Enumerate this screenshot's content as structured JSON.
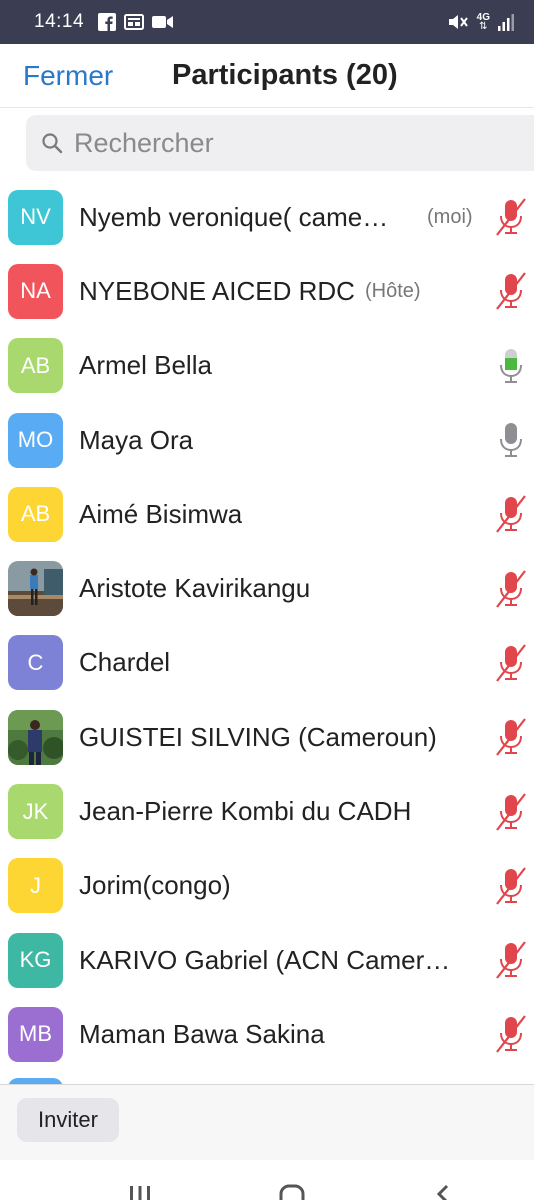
{
  "status_bar": {
    "time": "14:14",
    "left_icons": [
      "facebook-icon",
      "gallery-icon",
      "video-camera-icon"
    ],
    "right_icons": [
      "mute-vibrate-icon",
      "4g-data-icon",
      "signal-icon"
    ],
    "network_label": "4G"
  },
  "header": {
    "close_label": "Fermer",
    "title": "Participants (20)"
  },
  "search": {
    "placeholder": "Rechercher"
  },
  "colors": {
    "accent": "#2a78c9",
    "mic_muted": "#e0464b",
    "mic_active": "#4cb83f",
    "mic_idle": "#8e8e93"
  },
  "participants": [
    {
      "initials": "NV",
      "name": "Nyemb veronique( came…",
      "tag": "(moi)",
      "avatar_color": "#3ec6d6",
      "mic": "muted"
    },
    {
      "initials": "NA",
      "name": "NYEBONE AICED RDC",
      "tag": "(Hôte)",
      "avatar_color": "#f2545b",
      "mic": "muted"
    },
    {
      "initials": "AB",
      "name": "Armel Bella",
      "tag": "",
      "avatar_color": "#a8d86e",
      "mic": "active"
    },
    {
      "initials": "MO",
      "name": "Maya Ora",
      "tag": "",
      "avatar_color": "#59abf3",
      "mic": "idle"
    },
    {
      "initials": "AB",
      "name": "Aimé Bisimwa",
      "tag": "",
      "avatar_color": "#fdd633",
      "mic": "muted"
    },
    {
      "initials": "",
      "name": "Aristote Kavirikangu",
      "tag": "",
      "avatar_color": "#6b5a4a",
      "mic": "muted",
      "photo": true
    },
    {
      "initials": "C",
      "name": "Chardel",
      "tag": "",
      "avatar_color": "#7d82d6",
      "mic": "muted"
    },
    {
      "initials": "",
      "name": "GUISTEI SILVING (Cameroun)",
      "tag": "",
      "avatar_color": "#3b6b3a",
      "mic": "muted",
      "photo": true
    },
    {
      "initials": "JK",
      "name": "Jean-Pierre Kombi du CADH",
      "tag": "",
      "avatar_color": "#a8d86e",
      "mic": "muted"
    },
    {
      "initials": "J",
      "name": "Jorim(congo)",
      "tag": "",
      "avatar_color": "#fdd633",
      "mic": "muted"
    },
    {
      "initials": "KG",
      "name": "KARIVO Gabriel (ACN Camer…",
      "tag": "",
      "avatar_color": "#3eb8a3",
      "mic": "muted"
    },
    {
      "initials": "MB",
      "name": "Maman Bawa Sakina",
      "tag": "",
      "avatar_color": "#9a6fd1",
      "mic": "muted"
    }
  ],
  "bottom": {
    "invite_label": "Inviter"
  },
  "nav_bar": {
    "buttons": [
      "recent-apps-icon",
      "home-icon",
      "back-icon"
    ]
  }
}
